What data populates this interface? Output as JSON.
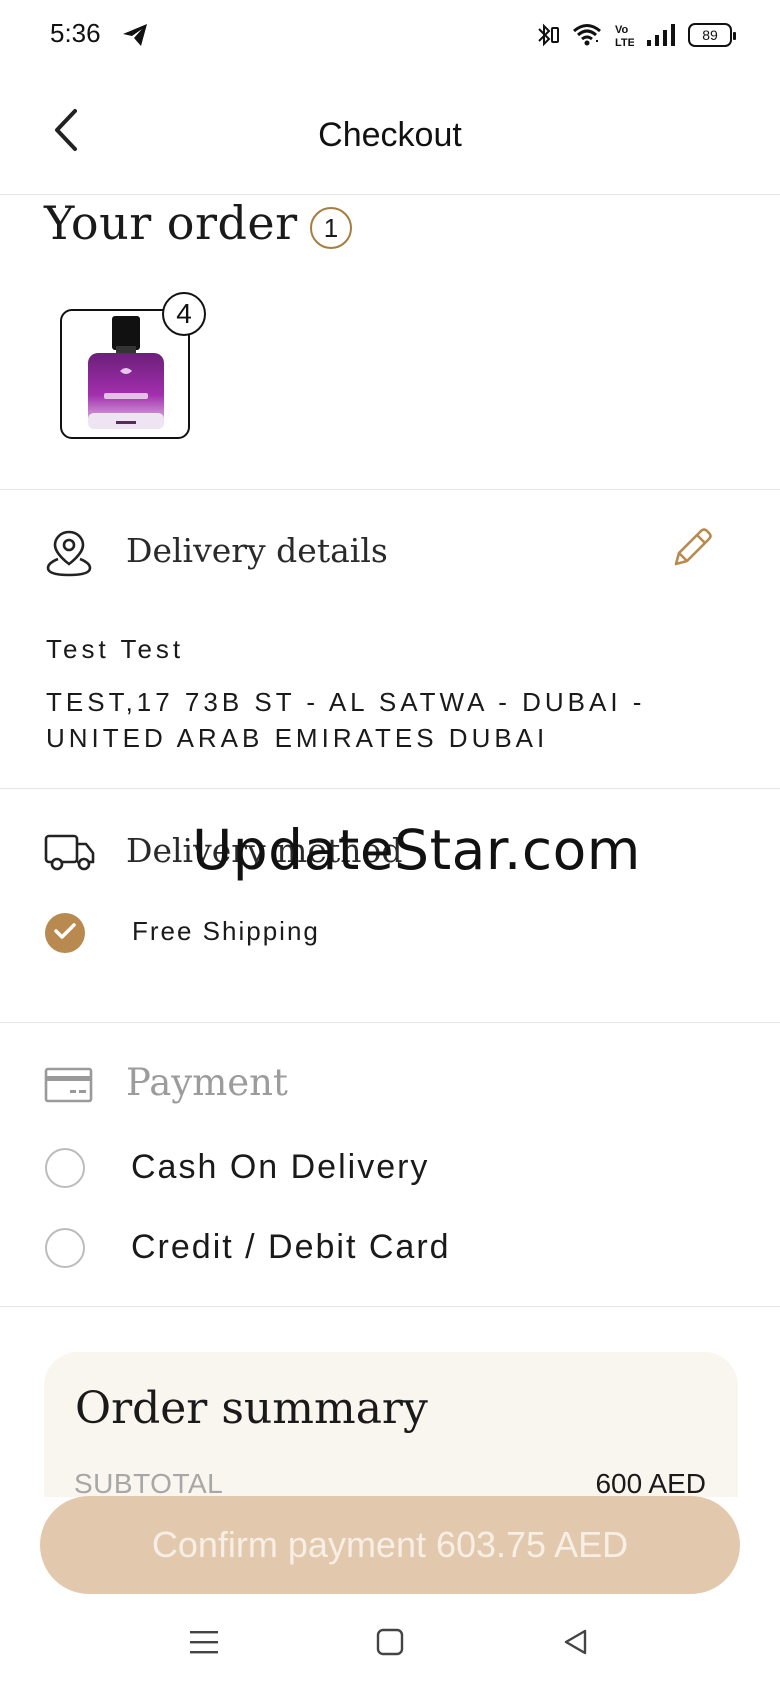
{
  "status_bar": {
    "time": "5:36",
    "battery": "89",
    "icons": [
      "telegram-send-icon",
      "bluetooth-icon",
      "wifi-icon",
      "volte-icon",
      "signal-icon",
      "battery-icon"
    ]
  },
  "header": {
    "title": "Checkout",
    "back_icon": "chevron-left-icon"
  },
  "order": {
    "title": "Your order",
    "count": "1",
    "items": [
      {
        "product_icon": "perfume-bottle-icon",
        "quantity": "4"
      }
    ]
  },
  "delivery_details": {
    "title": "Delivery details",
    "icon": "location-pin-icon",
    "edit_icon": "pencil-icon",
    "name": "Test Test",
    "address": "TEST,17 73B ST - AL SATWA - DUBAI - UNITED ARAB EMIRATES DUBAI"
  },
  "delivery_method": {
    "title": "Delivery method",
    "icon": "truck-icon",
    "selected_option": "Free Shipping"
  },
  "watermark": "UpdateStar.com",
  "payment": {
    "title": "Payment",
    "icon": "card-icon",
    "options": [
      "Cash On Delivery",
      "Credit / Debit Card"
    ]
  },
  "order_summary": {
    "title": "Order summary",
    "subtotal_label": "SUBTOTAL",
    "subtotal_value": "600 AED"
  },
  "confirm_button": {
    "label": "Confirm payment 603.75 AED"
  },
  "nav_bar": {
    "icons": [
      "menu-icon",
      "home-square-icon",
      "back-triangle-icon"
    ]
  },
  "colors": {
    "accent": "#b98a4f",
    "button_bg": "#e2c9ad",
    "summary_bg": "#f9f5ef"
  }
}
